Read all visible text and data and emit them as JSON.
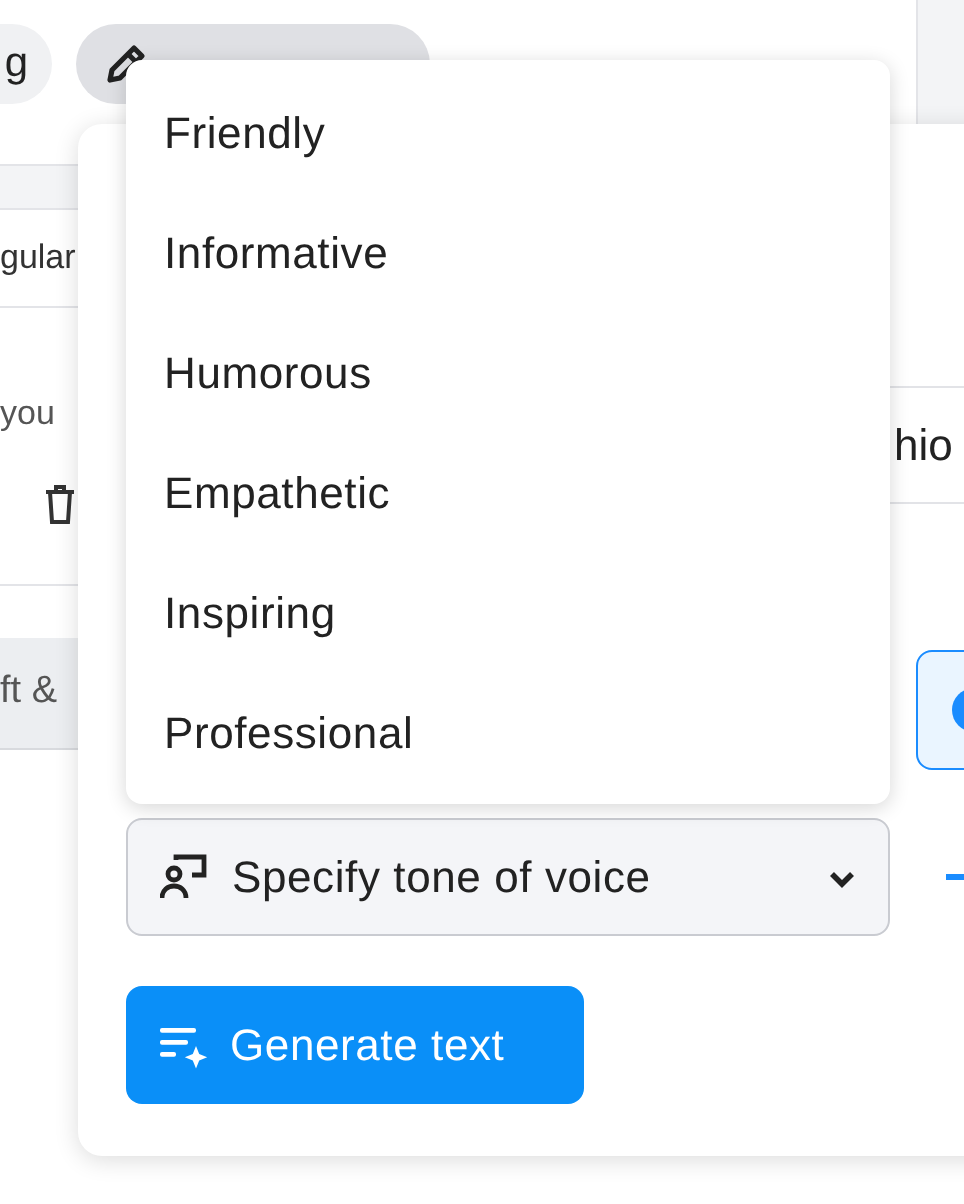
{
  "background_chips": [
    {
      "label": "g",
      "selected": false
    },
    {
      "selected": true
    }
  ],
  "left_panel": {
    "field_text": "gular",
    "text": "you",
    "button": "ft &"
  },
  "panel": {
    "field_text": "hio"
  },
  "tone_menu": {
    "expanded": true,
    "options": [
      {
        "label": "Friendly"
      },
      {
        "label": "Informative"
      },
      {
        "label": "Humorous"
      },
      {
        "label": "Empathetic"
      },
      {
        "label": "Inspiring"
      },
      {
        "label": "Professional"
      }
    ]
  },
  "tone_select": {
    "label": "Specify tone of voice"
  },
  "generate_button": "Generate text"
}
